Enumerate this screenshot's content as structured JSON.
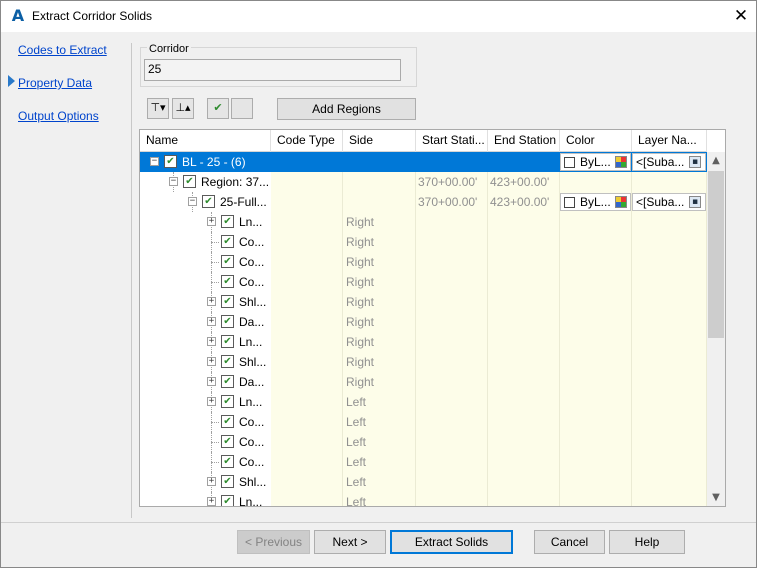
{
  "window": {
    "title": "Extract Corridor Solids",
    "app_icon": "autocad-a-icon",
    "close_glyph": "✕"
  },
  "nav": {
    "items": [
      "Codes to Extract",
      "Property Data",
      "Output Options"
    ],
    "active_index": 0
  },
  "corridor": {
    "label": "Corridor",
    "value": "25"
  },
  "toolbar": {
    "expand_glyph": "⊤▾",
    "collapse_glyph": "⊥▴",
    "check_all_glyph": "✔",
    "uncheck_all_glyph": "",
    "add_regions_label": "Add Regions"
  },
  "grid": {
    "columns": [
      "Name",
      "Code Type",
      "Side",
      "Start Stati...",
      "End Station",
      "Color",
      "Layer Na..."
    ],
    "rows": [
      {
        "level": 0,
        "expander": "−",
        "name": "BL - 25 - (6)",
        "code_type": "",
        "side": "",
        "start": "",
        "end": "",
        "color": "ByL...",
        "layer": "<[Suba...",
        "selected": true
      },
      {
        "level": 1,
        "expander": "−",
        "name": "Region: 37...",
        "code_type": "",
        "side": "",
        "start": "370+00.00'",
        "end": "423+00.00'",
        "color": "",
        "layer": ""
      },
      {
        "level": 2,
        "expander": "−",
        "name": "25-Full...",
        "code_type": "",
        "side": "",
        "start": "370+00.00'",
        "end": "423+00.00'",
        "color": "ByL...",
        "layer": "<[Suba..."
      },
      {
        "level": 3,
        "expander": "+",
        "name": "Ln...",
        "code_type": "",
        "side": "Right",
        "start": "",
        "end": "",
        "color": "",
        "layer": ""
      },
      {
        "level": 3,
        "expander": "",
        "name": "Co...",
        "code_type": "",
        "side": "Right",
        "start": "",
        "end": "",
        "color": "",
        "layer": ""
      },
      {
        "level": 3,
        "expander": "",
        "name": "Co...",
        "code_type": "",
        "side": "Right",
        "start": "",
        "end": "",
        "color": "",
        "layer": ""
      },
      {
        "level": 3,
        "expander": "",
        "name": "Co...",
        "code_type": "",
        "side": "Right",
        "start": "",
        "end": "",
        "color": "",
        "layer": ""
      },
      {
        "level": 3,
        "expander": "+",
        "name": "Shl...",
        "code_type": "",
        "side": "Right",
        "start": "",
        "end": "",
        "color": "",
        "layer": ""
      },
      {
        "level": 3,
        "expander": "+",
        "name": "Da...",
        "code_type": "",
        "side": "Right",
        "start": "",
        "end": "",
        "color": "",
        "layer": ""
      },
      {
        "level": 3,
        "expander": "+",
        "name": "Ln...",
        "code_type": "",
        "side": "Right",
        "start": "",
        "end": "",
        "color": "",
        "layer": ""
      },
      {
        "level": 3,
        "expander": "+",
        "name": "Shl...",
        "code_type": "",
        "side": "Right",
        "start": "",
        "end": "",
        "color": "",
        "layer": ""
      },
      {
        "level": 3,
        "expander": "+",
        "name": "Da...",
        "code_type": "",
        "side": "Right",
        "start": "",
        "end": "",
        "color": "",
        "layer": ""
      },
      {
        "level": 3,
        "expander": "+",
        "name": "Ln...",
        "code_type": "",
        "side": "Left",
        "start": "",
        "end": "",
        "color": "",
        "layer": ""
      },
      {
        "level": 3,
        "expander": "",
        "name": "Co...",
        "code_type": "",
        "side": "Left",
        "start": "",
        "end": "",
        "color": "",
        "layer": ""
      },
      {
        "level": 3,
        "expander": "",
        "name": "Co...",
        "code_type": "",
        "side": "Left",
        "start": "",
        "end": "",
        "color": "",
        "layer": ""
      },
      {
        "level": 3,
        "expander": "",
        "name": "Co...",
        "code_type": "",
        "side": "Left",
        "start": "",
        "end": "",
        "color": "",
        "layer": ""
      },
      {
        "level": 3,
        "expander": "+",
        "name": "Shl...",
        "code_type": "",
        "side": "Left",
        "start": "",
        "end": "",
        "color": "",
        "layer": ""
      },
      {
        "level": 3,
        "expander": "+",
        "name": "Ln...",
        "code_type": "",
        "side": "Left",
        "start": "",
        "end": "",
        "color": "",
        "layer": ""
      }
    ]
  },
  "scrollbar": {
    "up_glyph": "▲",
    "down_glyph": "▼"
  },
  "buttons": {
    "previous": "< Previous",
    "next": "Next >",
    "extract": "Extract Solids",
    "cancel": "Cancel",
    "help": "Help"
  },
  "colors": {
    "selection": "#0078d7",
    "link": "#0044cc",
    "cell_bg": "#fdfde9",
    "check": "#2e8b2e"
  }
}
